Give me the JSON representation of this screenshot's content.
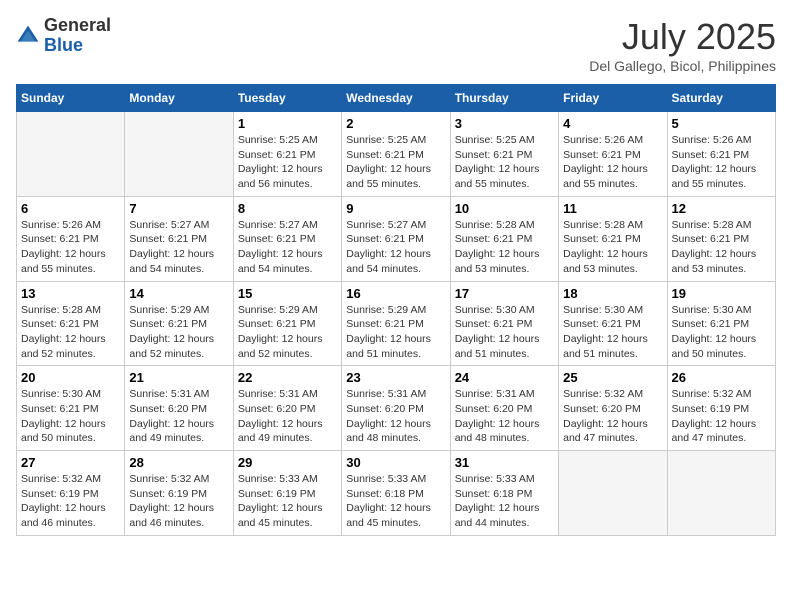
{
  "header": {
    "logo": {
      "general": "General",
      "blue": "Blue"
    },
    "title": "July 2025",
    "location": "Del Gallego, Bicol, Philippines"
  },
  "calendar": {
    "days_of_week": [
      "Sunday",
      "Monday",
      "Tuesday",
      "Wednesday",
      "Thursday",
      "Friday",
      "Saturday"
    ],
    "weeks": [
      [
        {
          "day": "",
          "info": ""
        },
        {
          "day": "",
          "info": ""
        },
        {
          "day": "1",
          "info": "Sunrise: 5:25 AM\nSunset: 6:21 PM\nDaylight: 12 hours and 56 minutes."
        },
        {
          "day": "2",
          "info": "Sunrise: 5:25 AM\nSunset: 6:21 PM\nDaylight: 12 hours and 55 minutes."
        },
        {
          "day": "3",
          "info": "Sunrise: 5:25 AM\nSunset: 6:21 PM\nDaylight: 12 hours and 55 minutes."
        },
        {
          "day": "4",
          "info": "Sunrise: 5:26 AM\nSunset: 6:21 PM\nDaylight: 12 hours and 55 minutes."
        },
        {
          "day": "5",
          "info": "Sunrise: 5:26 AM\nSunset: 6:21 PM\nDaylight: 12 hours and 55 minutes."
        }
      ],
      [
        {
          "day": "6",
          "info": "Sunrise: 5:26 AM\nSunset: 6:21 PM\nDaylight: 12 hours and 55 minutes."
        },
        {
          "day": "7",
          "info": "Sunrise: 5:27 AM\nSunset: 6:21 PM\nDaylight: 12 hours and 54 minutes."
        },
        {
          "day": "8",
          "info": "Sunrise: 5:27 AM\nSunset: 6:21 PM\nDaylight: 12 hours and 54 minutes."
        },
        {
          "day": "9",
          "info": "Sunrise: 5:27 AM\nSunset: 6:21 PM\nDaylight: 12 hours and 54 minutes."
        },
        {
          "day": "10",
          "info": "Sunrise: 5:28 AM\nSunset: 6:21 PM\nDaylight: 12 hours and 53 minutes."
        },
        {
          "day": "11",
          "info": "Sunrise: 5:28 AM\nSunset: 6:21 PM\nDaylight: 12 hours and 53 minutes."
        },
        {
          "day": "12",
          "info": "Sunrise: 5:28 AM\nSunset: 6:21 PM\nDaylight: 12 hours and 53 minutes."
        }
      ],
      [
        {
          "day": "13",
          "info": "Sunrise: 5:28 AM\nSunset: 6:21 PM\nDaylight: 12 hours and 52 minutes."
        },
        {
          "day": "14",
          "info": "Sunrise: 5:29 AM\nSunset: 6:21 PM\nDaylight: 12 hours and 52 minutes."
        },
        {
          "day": "15",
          "info": "Sunrise: 5:29 AM\nSunset: 6:21 PM\nDaylight: 12 hours and 52 minutes."
        },
        {
          "day": "16",
          "info": "Sunrise: 5:29 AM\nSunset: 6:21 PM\nDaylight: 12 hours and 51 minutes."
        },
        {
          "day": "17",
          "info": "Sunrise: 5:30 AM\nSunset: 6:21 PM\nDaylight: 12 hours and 51 minutes."
        },
        {
          "day": "18",
          "info": "Sunrise: 5:30 AM\nSunset: 6:21 PM\nDaylight: 12 hours and 51 minutes."
        },
        {
          "day": "19",
          "info": "Sunrise: 5:30 AM\nSunset: 6:21 PM\nDaylight: 12 hours and 50 minutes."
        }
      ],
      [
        {
          "day": "20",
          "info": "Sunrise: 5:30 AM\nSunset: 6:21 PM\nDaylight: 12 hours and 50 minutes."
        },
        {
          "day": "21",
          "info": "Sunrise: 5:31 AM\nSunset: 6:20 PM\nDaylight: 12 hours and 49 minutes."
        },
        {
          "day": "22",
          "info": "Sunrise: 5:31 AM\nSunset: 6:20 PM\nDaylight: 12 hours and 49 minutes."
        },
        {
          "day": "23",
          "info": "Sunrise: 5:31 AM\nSunset: 6:20 PM\nDaylight: 12 hours and 48 minutes."
        },
        {
          "day": "24",
          "info": "Sunrise: 5:31 AM\nSunset: 6:20 PM\nDaylight: 12 hours and 48 minutes."
        },
        {
          "day": "25",
          "info": "Sunrise: 5:32 AM\nSunset: 6:20 PM\nDaylight: 12 hours and 47 minutes."
        },
        {
          "day": "26",
          "info": "Sunrise: 5:32 AM\nSunset: 6:19 PM\nDaylight: 12 hours and 47 minutes."
        }
      ],
      [
        {
          "day": "27",
          "info": "Sunrise: 5:32 AM\nSunset: 6:19 PM\nDaylight: 12 hours and 46 minutes."
        },
        {
          "day": "28",
          "info": "Sunrise: 5:32 AM\nSunset: 6:19 PM\nDaylight: 12 hours and 46 minutes."
        },
        {
          "day": "29",
          "info": "Sunrise: 5:33 AM\nSunset: 6:19 PM\nDaylight: 12 hours and 45 minutes."
        },
        {
          "day": "30",
          "info": "Sunrise: 5:33 AM\nSunset: 6:18 PM\nDaylight: 12 hours and 45 minutes."
        },
        {
          "day": "31",
          "info": "Sunrise: 5:33 AM\nSunset: 6:18 PM\nDaylight: 12 hours and 44 minutes."
        },
        {
          "day": "",
          "info": ""
        },
        {
          "day": "",
          "info": ""
        }
      ]
    ]
  }
}
